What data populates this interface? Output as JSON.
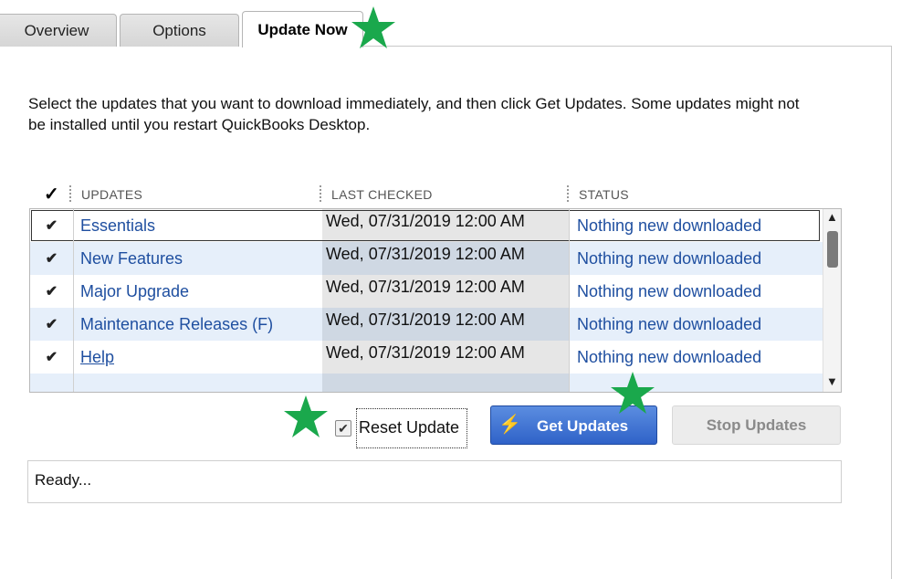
{
  "tabs": {
    "overview": "Overview",
    "options": "Options",
    "update_now": "Update Now"
  },
  "intro_text": "Select the updates that you want to download immediately, and then click Get Updates. Some updates might not be installed until you restart QuickBooks Desktop.",
  "table": {
    "headers": {
      "check": "✓",
      "updates": "UPDATES",
      "last_checked": "LAST CHECKED",
      "status": "STATUS"
    },
    "rows": [
      {
        "checked": "✔",
        "name": "Essentials",
        "last_checked": "Wed, 07/31/2019 12:00 AM",
        "status": "Nothing new downloaded"
      },
      {
        "checked": "✔",
        "name": "New Features",
        "last_checked": "Wed, 07/31/2019 12:00 AM",
        "status": "Nothing new downloaded"
      },
      {
        "checked": "✔",
        "name": "Major Upgrade",
        "last_checked": "Wed, 07/31/2019 12:00 AM",
        "status": "Nothing new downloaded"
      },
      {
        "checked": "✔",
        "name": "Maintenance Releases (F)",
        "last_checked": "Wed, 07/31/2019 12:00 AM",
        "status": "Nothing new downloaded"
      },
      {
        "checked": "✔",
        "name": "Help",
        "last_checked": "Wed, 07/31/2019 12:00 AM",
        "status": "Nothing new downloaded"
      }
    ]
  },
  "controls": {
    "reset_update_label": "Reset Update",
    "reset_update_checked": true,
    "get_updates_label": "Get Updates",
    "stop_updates_label": "Stop Updates"
  },
  "status_text": "Ready...",
  "colors": {
    "link_blue": "#1f4fa0",
    "button_blue": "#2f62c8",
    "star_green": "#1aa84c"
  }
}
